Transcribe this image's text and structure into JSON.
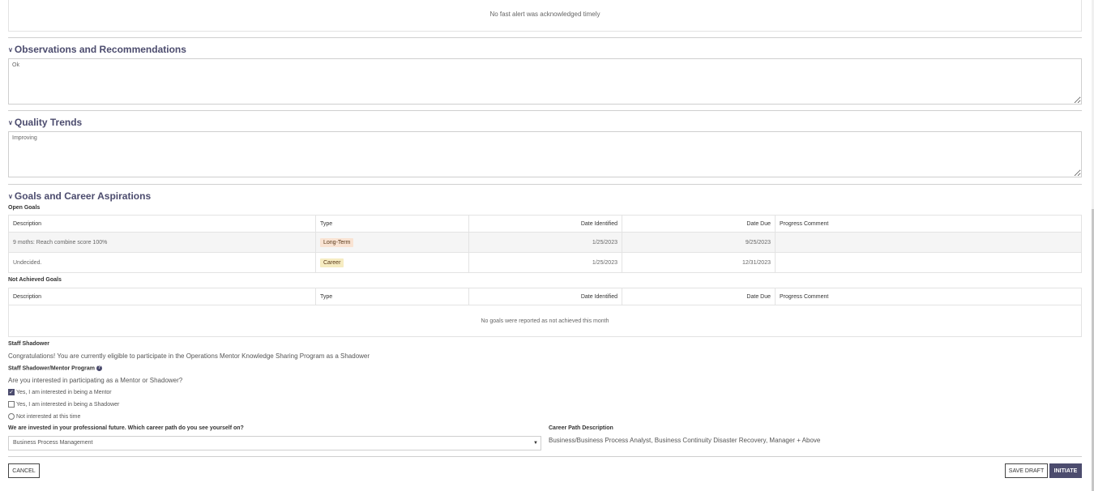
{
  "alert": {
    "text": "No fast alert was acknowledged timely"
  },
  "observations": {
    "title": "Observations and Recommendations",
    "value": "Ok"
  },
  "quality": {
    "title": "Quality Trends",
    "value": "Improving"
  },
  "goals": {
    "title": "Goals and Career Aspirations",
    "open_label": "Open Goals",
    "columns": [
      "Description",
      "Type",
      "Date Identified",
      "Date Due",
      "Progress Comment"
    ],
    "open_rows": [
      {
        "description": "9 moths: Reach combine score 100%",
        "type": "Long-Term",
        "identified": "1/25/2023",
        "due": "9/25/2023",
        "comment": ""
      },
      {
        "description": "Undecided.",
        "type": "Career",
        "identified": "1/25/2023",
        "due": "12/31/2023",
        "comment": ""
      }
    ],
    "not_achieved_label": "Not Achieved Goals",
    "not_achieved_empty": "No goals were reported as not achieved this month"
  },
  "shadow": {
    "title": "Staff Shadower",
    "text": "Congratulations! You are currently eligible to participate in the Operations Mentor Knowledge Sharing Program as a Shadower",
    "program_label": "Staff Shadower/Mentor Program",
    "question": "Are you interested in participating as a Mentor or Shadower?",
    "options": [
      {
        "label": "Yes, I am interested in being a Mentor",
        "checked": true
      },
      {
        "label": "Yes, I am interested in being a Shadower",
        "checked": false
      },
      {
        "label": "Not interested at this time",
        "checked": false
      }
    ]
  },
  "career": {
    "question": "We are invested in your professional future. Which career path do you see yourself on?",
    "selected": "Business Process Management",
    "desc_label": "Career Path Description",
    "desc": "Business/Business Process Analyst, Business Continuity Disaster Recovery, Manager + Above"
  },
  "actions": {
    "cancel": "CANCEL",
    "save_draft": "SAVE DRAFT",
    "initiate": "INITIATE"
  },
  "icons": {
    "chevron": "chevron-down-icon",
    "help": "help-circle-icon",
    "caret": "caret-down-icon",
    "check": "check-icon"
  },
  "colors": {
    "accent": "#4c4c6e",
    "tag_longterm": "#f9e3d3",
    "tag_career": "#f6ecc2"
  }
}
